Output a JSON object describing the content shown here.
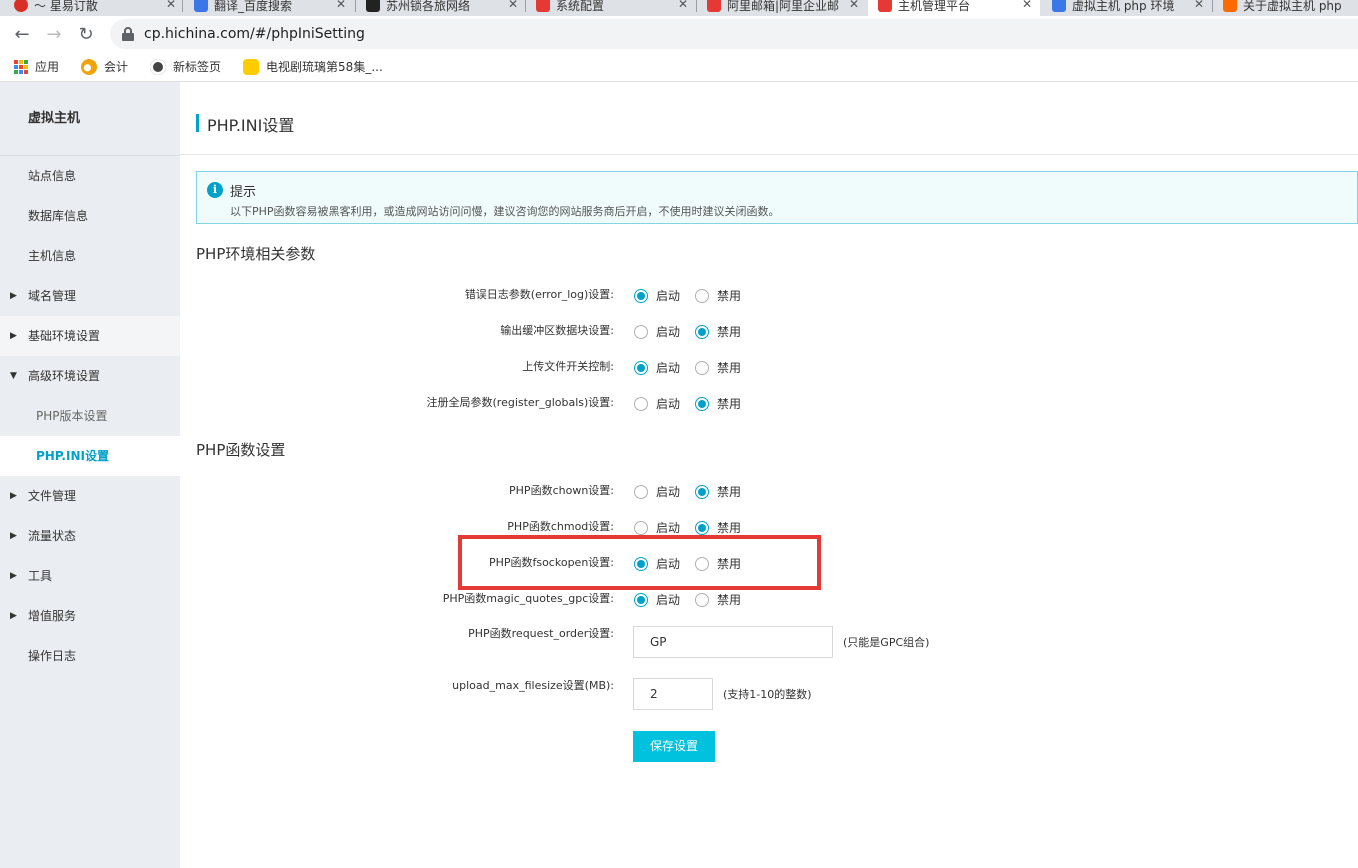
{
  "browser": {
    "tabs": [
      {
        "label": "～ 星易订散",
        "icon_color": "#d93025"
      },
      {
        "label": "翻译_百度搜索",
        "icon_color": "#3b77e8"
      },
      {
        "label": "苏州锁各旅网络",
        "icon_color": "#222222"
      },
      {
        "label": "系统配置",
        "icon_color": "#e53935"
      },
      {
        "label": "阿里邮箱|阿里企业邮",
        "icon_color": "#e53935"
      },
      {
        "label": "主机管理平台",
        "icon_color": "#e53935"
      },
      {
        "label": "虚拟主机 php 环境",
        "icon_color": "#3b77e8"
      },
      {
        "label": "关于虚拟主机 php",
        "icon_color": "#ff6a00"
      }
    ],
    "url": "cp.hichina.com/#/phpIniSetting",
    "bookmarks": [
      {
        "label": "应用",
        "icon": "apps-grid-icon"
      },
      {
        "label": "会计",
        "icon": "weibo-icon"
      },
      {
        "label": "新标签页",
        "icon": "globe-icon"
      },
      {
        "label": "电视剧琉璃第58集_...",
        "icon": "video-icon"
      }
    ]
  },
  "sidebar": {
    "title": "虚拟主机",
    "items": [
      {
        "label": "站点信息",
        "caret": ""
      },
      {
        "label": "数据库信息",
        "caret": ""
      },
      {
        "label": "主机信息",
        "caret": ""
      },
      {
        "label": "域名管理",
        "caret": "▶"
      },
      {
        "label": "基础环境设置",
        "caret": "▶"
      },
      {
        "label": "高级环境设置",
        "caret": "▼"
      },
      {
        "label": "PHP版本设置",
        "caret": ""
      },
      {
        "label": "PHP.INI设置",
        "caret": ""
      },
      {
        "label": "文件管理",
        "caret": "▶"
      },
      {
        "label": "流量状态",
        "caret": "▶"
      },
      {
        "label": "工具",
        "caret": "▶"
      },
      {
        "label": "增值服务",
        "caret": "▶"
      },
      {
        "label": "操作日志",
        "caret": ""
      }
    ]
  },
  "page": {
    "title": "PHP.INI设置",
    "notice": {
      "title": "提示",
      "text": "以下PHP函数容易被黑客利用，或造成网站访问问慢，建议咨询您的网站服务商后开启，不使用时建议关闭函数。"
    },
    "env_section": {
      "title": "PHP环境相关参数",
      "rows": [
        {
          "label": "错误日志参数(error_log)设置:",
          "enable": "启动",
          "disable": "禁用",
          "value": "enable"
        },
        {
          "label": "输出缓冲区数据块设置:",
          "enable": "启动",
          "disable": "禁用",
          "value": "disable"
        },
        {
          "label": "上传文件开关控制:",
          "enable": "启动",
          "disable": "禁用",
          "value": "enable"
        },
        {
          "label": "注册全局参数(register_globals)设置:",
          "enable": "启动",
          "disable": "禁用",
          "value": "disable"
        }
      ]
    },
    "func_section": {
      "title": "PHP函数设置",
      "rows": [
        {
          "label": "PHP函数chown设置:",
          "enable": "启动",
          "disable": "禁用",
          "value": "disable"
        },
        {
          "label": "PHP函数chmod设置:",
          "enable": "启动",
          "disable": "禁用",
          "value": "disable"
        },
        {
          "label": "PHP函数fsockopen设置:",
          "enable": "启动",
          "disable": "禁用",
          "value": "enable"
        },
        {
          "label": "PHP函数magic_quotes_gpc设置:",
          "enable": "启动",
          "disable": "禁用",
          "value": "enable"
        }
      ],
      "request_order": {
        "label": "PHP函数request_order设置:",
        "value": "GP",
        "hint": "(只能是GPC组合)"
      },
      "upload_max": {
        "label": "upload_max_filesize设置(MB):",
        "value": "2",
        "hint": "(支持1-10的整数)"
      }
    },
    "save_label": "保存设置",
    "highlight_color": "#e53935",
    "accent_color": "#00a2ca"
  }
}
